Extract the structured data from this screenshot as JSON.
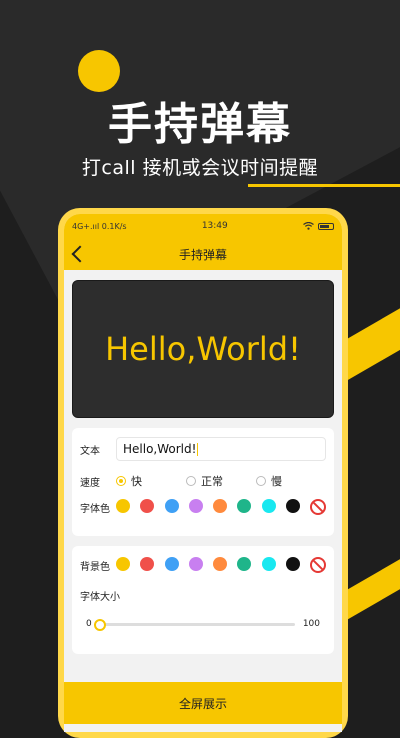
{
  "promo": {
    "headline": "手持弹幕",
    "subline": "打call 接机或会议时间提醒"
  },
  "status_bar": {
    "network": "4G+.ııl 0.1K/s",
    "time": "13:49",
    "wifi_icon": "wifi-icon",
    "battery_icon": "battery-icon"
  },
  "app_bar": {
    "title": "手持弹幕",
    "back_icon": "back-chevron-icon"
  },
  "preview": {
    "text": "Hello,World!",
    "text_color": "#f7c600",
    "background": "#2d2d2d"
  },
  "text_settings": {
    "text_label": "文本",
    "text_value": "Hello,World!",
    "speed_label": "速度",
    "speed_options": [
      {
        "label": "快",
        "selected": true
      },
      {
        "label": "正常",
        "selected": false
      },
      {
        "label": "慢",
        "selected": false
      }
    ],
    "font_color_label": "字体色"
  },
  "background_settings": {
    "bg_color_label": "背景色",
    "font_size_label": "字体大小",
    "font_size_min": "0",
    "font_size_max": "100",
    "font_size_value": 0
  },
  "palette": [
    "#f7c600",
    "#f0504a",
    "#3fa0f5",
    "#c87ff0",
    "#ff8a3d",
    "#1fb58a",
    "#19e8f0",
    "#111111"
  ],
  "fullscreen_button": "全屏展示",
  "accent_color": "#f7c600"
}
